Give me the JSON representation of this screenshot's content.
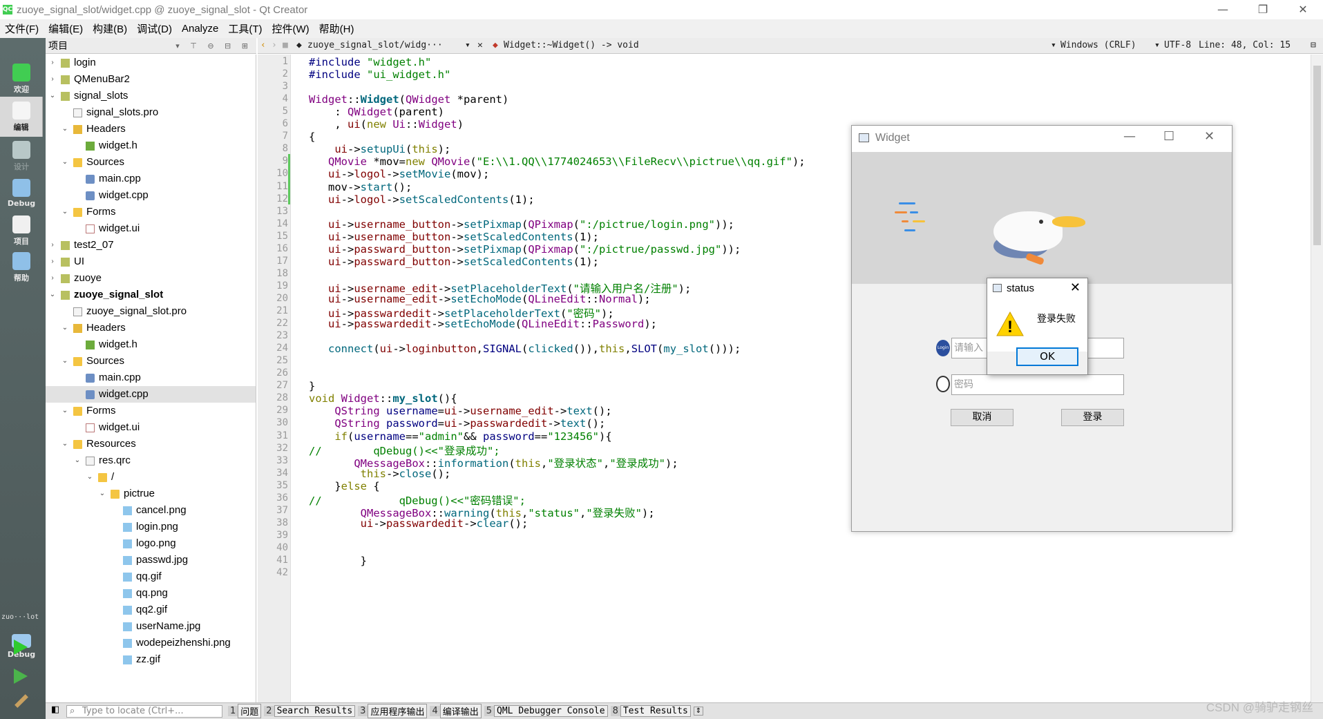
{
  "window": {
    "title": "zuoye_signal_slot/widget.cpp @ zuoye_signal_slot - Qt Creator",
    "app_icon": "QC"
  },
  "menu": [
    "文件(F)",
    "编辑(E)",
    "构建(B)",
    "调试(D)",
    "Analyze",
    "工具(T)",
    "控件(W)",
    "帮助(H)"
  ],
  "modes": [
    {
      "label": "欢迎",
      "icon": "qt-welcome-icon"
    },
    {
      "label": "编辑",
      "icon": "edit-icon"
    },
    {
      "label": "设计",
      "icon": "design-icon"
    },
    {
      "label": "Debug",
      "icon": "debug-icon"
    },
    {
      "label": "项目",
      "icon": "projects-icon"
    },
    {
      "label": "帮助",
      "icon": "help-icon"
    }
  ],
  "kit": {
    "label": "zuo···lot",
    "mode": "Debug"
  },
  "project_pane": {
    "title": "项目"
  },
  "tree": [
    {
      "label": "login",
      "indent": 0,
      "arrow": "›",
      "icon": "proj"
    },
    {
      "label": "QMenuBar2",
      "indent": 0,
      "arrow": "›",
      "icon": "proj"
    },
    {
      "label": "signal_slots",
      "indent": 0,
      "arrow": "⌄",
      "icon": "proj"
    },
    {
      "label": "signal_slots.pro",
      "indent": 1,
      "arrow": "",
      "icon": "pro"
    },
    {
      "label": "Headers",
      "indent": 1,
      "arrow": "⌄",
      "icon": "folder-g"
    },
    {
      "label": "widget.h",
      "indent": 2,
      "arrow": "",
      "icon": "h"
    },
    {
      "label": "Sources",
      "indent": 1,
      "arrow": "⌄",
      "icon": "folder"
    },
    {
      "label": "main.cpp",
      "indent": 2,
      "arrow": "",
      "icon": "cpp"
    },
    {
      "label": "widget.cpp",
      "indent": 2,
      "arrow": "",
      "icon": "cpp"
    },
    {
      "label": "Forms",
      "indent": 1,
      "arrow": "⌄",
      "icon": "folder"
    },
    {
      "label": "widget.ui",
      "indent": 2,
      "arrow": "",
      "icon": "ui"
    },
    {
      "label": "test2_07",
      "indent": 0,
      "arrow": "›",
      "icon": "proj"
    },
    {
      "label": "UI",
      "indent": 0,
      "arrow": "›",
      "icon": "proj"
    },
    {
      "label": "zuoye",
      "indent": 0,
      "arrow": "›",
      "icon": "proj"
    },
    {
      "label": "zuoye_signal_slot",
      "indent": 0,
      "arrow": "⌄",
      "icon": "proj",
      "bold": true
    },
    {
      "label": "zuoye_signal_slot.pro",
      "indent": 1,
      "arrow": "",
      "icon": "pro"
    },
    {
      "label": "Headers",
      "indent": 1,
      "arrow": "⌄",
      "icon": "folder-g"
    },
    {
      "label": "widget.h",
      "indent": 2,
      "arrow": "",
      "icon": "h"
    },
    {
      "label": "Sources",
      "indent": 1,
      "arrow": "⌄",
      "icon": "folder"
    },
    {
      "label": "main.cpp",
      "indent": 2,
      "arrow": "",
      "icon": "cpp"
    },
    {
      "label": "widget.cpp",
      "indent": 2,
      "arrow": "",
      "icon": "cpp",
      "selected": true
    },
    {
      "label": "Forms",
      "indent": 1,
      "arrow": "⌄",
      "icon": "folder"
    },
    {
      "label": "widget.ui",
      "indent": 2,
      "arrow": "",
      "icon": "ui"
    },
    {
      "label": "Resources",
      "indent": 1,
      "arrow": "⌄",
      "icon": "folder"
    },
    {
      "label": "res.qrc",
      "indent": 2,
      "arrow": "⌄",
      "icon": "pro"
    },
    {
      "label": "/",
      "indent": 3,
      "arrow": "⌄",
      "icon": "folder"
    },
    {
      "label": "pictrue",
      "indent": 4,
      "arrow": "⌄",
      "icon": "folder"
    },
    {
      "label": "cancel.png",
      "indent": 5,
      "arrow": "",
      "icon": "img"
    },
    {
      "label": "login.png",
      "indent": 5,
      "arrow": "",
      "icon": "img"
    },
    {
      "label": "logo.png",
      "indent": 5,
      "arrow": "",
      "icon": "img"
    },
    {
      "label": "passwd.jpg",
      "indent": 5,
      "arrow": "",
      "icon": "img"
    },
    {
      "label": "qq.gif",
      "indent": 5,
      "arrow": "",
      "icon": "img"
    },
    {
      "label": "qq.png",
      "indent": 5,
      "arrow": "",
      "icon": "img"
    },
    {
      "label": "qq2.gif",
      "indent": 5,
      "arrow": "",
      "icon": "img"
    },
    {
      "label": "userName.jpg",
      "indent": 5,
      "arrow": "",
      "icon": "img"
    },
    {
      "label": "wodepeizhenshi.png",
      "indent": 5,
      "arrow": "",
      "icon": "img"
    },
    {
      "label": "zz.gif",
      "indent": 5,
      "arrow": "",
      "icon": "img"
    }
  ],
  "editor": {
    "file_combo": "zuoye_signal_slot/widg···",
    "symbol_combo": "Widget::~Widget() -> void",
    "line_ending": "Windows (CRLF)",
    "encoding": "UTF-8",
    "position": "Line: 48, Col: 15"
  },
  "code": [
    [
      [
        "#include ",
        "#000080"
      ],
      [
        "\"widget.h\"",
        "#008000"
      ]
    ],
    [
      [
        "#include ",
        "#000080"
      ],
      [
        "\"ui_widget.h\"",
        "#008000"
      ]
    ],
    [],
    [
      [
        "Widget",
        "#800080"
      ],
      [
        "::",
        ""
      ],
      [
        "Widget",
        "#00677c",
        "b"
      ],
      [
        "(",
        ""
      ],
      [
        "QWidget",
        "#800080"
      ],
      [
        " *parent)",
        ""
      ]
    ],
    [
      [
        "    : ",
        ""
      ],
      [
        "QWidget",
        "#800080"
      ],
      [
        "(parent)",
        ""
      ]
    ],
    [
      [
        "    , ",
        ""
      ],
      [
        "ui",
        "#800000"
      ],
      [
        "(",
        ""
      ],
      [
        "new ",
        "#808000"
      ],
      [
        "Ui",
        "#800080"
      ],
      [
        "::",
        ""
      ],
      [
        "Widget",
        "#800080"
      ],
      [
        ")",
        ""
      ]
    ],
    [
      [
        "{",
        ""
      ]
    ],
    [
      [
        "    ",
        ""
      ],
      [
        "ui",
        "#800000"
      ],
      [
        "->",
        ""
      ],
      [
        "setupUi",
        "#00677c"
      ],
      [
        "(",
        ""
      ],
      [
        "this",
        "#808000"
      ],
      [
        ");",
        ""
      ]
    ],
    [
      [
        "   ",
        ""
      ],
      [
        "QMovie",
        "#800080"
      ],
      [
        " *mov=",
        ""
      ],
      [
        "new ",
        "#808000"
      ],
      [
        "QMovie",
        "#800080"
      ],
      [
        "(",
        ""
      ],
      [
        "\"E:\\\\1.QQ\\\\1774024653\\\\FileRecv\\\\pictrue\\\\qq.gif\"",
        "#008000"
      ],
      [
        ");",
        ""
      ]
    ],
    [
      [
        "   ",
        ""
      ],
      [
        "ui",
        "#800000"
      ],
      [
        "->",
        ""
      ],
      [
        "logol",
        "#800000"
      ],
      [
        "->",
        ""
      ],
      [
        "setMovie",
        "#00677c"
      ],
      [
        "(mov);",
        ""
      ]
    ],
    [
      [
        "   mov->",
        ""
      ],
      [
        "start",
        "#00677c"
      ],
      [
        "();",
        ""
      ]
    ],
    [
      [
        "   ",
        ""
      ],
      [
        "ui",
        "#800000"
      ],
      [
        "->",
        ""
      ],
      [
        "logol",
        "#800000"
      ],
      [
        "->",
        ""
      ],
      [
        "setScaledContents",
        "#00677c"
      ],
      [
        "(1);",
        ""
      ]
    ],
    [],
    [
      [
        "   ",
        ""
      ],
      [
        "ui",
        "#800000"
      ],
      [
        "->",
        ""
      ],
      [
        "username_button",
        "#800000"
      ],
      [
        "->",
        ""
      ],
      [
        "setPixmap",
        "#00677c"
      ],
      [
        "(",
        ""
      ],
      [
        "QPixmap",
        "#800080"
      ],
      [
        "(",
        ""
      ],
      [
        "\":/pictrue/login.png\"",
        "#008000"
      ],
      [
        "));",
        ""
      ]
    ],
    [
      [
        "   ",
        ""
      ],
      [
        "ui",
        "#800000"
      ],
      [
        "->",
        ""
      ],
      [
        "username_button",
        "#800000"
      ],
      [
        "->",
        ""
      ],
      [
        "setScaledContents",
        "#00677c"
      ],
      [
        "(1);",
        ""
      ]
    ],
    [
      [
        "   ",
        ""
      ],
      [
        "ui",
        "#800000"
      ],
      [
        "->",
        ""
      ],
      [
        "passward_button",
        "#800000"
      ],
      [
        "->",
        ""
      ],
      [
        "setPixmap",
        "#00677c"
      ],
      [
        "(",
        ""
      ],
      [
        "QPixmap",
        "#800080"
      ],
      [
        "(",
        ""
      ],
      [
        "\":/pictrue/passwd.jpg\"",
        "#008000"
      ],
      [
        "));",
        ""
      ]
    ],
    [
      [
        "   ",
        ""
      ],
      [
        "ui",
        "#800000"
      ],
      [
        "->",
        ""
      ],
      [
        "passward_button",
        "#800000"
      ],
      [
        "->",
        ""
      ],
      [
        "setScaledContents",
        "#00677c"
      ],
      [
        "(1);",
        ""
      ]
    ],
    [],
    [
      [
        "   ",
        ""
      ],
      [
        "ui",
        "#800000"
      ],
      [
        "->",
        ""
      ],
      [
        "username_edit",
        "#800000"
      ],
      [
        "->",
        ""
      ],
      [
        "setPlaceholderText",
        "#00677c"
      ],
      [
        "(",
        ""
      ],
      [
        "\"请输入用户名/注册\"",
        "#008000"
      ],
      [
        ");",
        ""
      ]
    ],
    [
      [
        "   ",
        ""
      ],
      [
        "ui",
        "#800000"
      ],
      [
        "->",
        ""
      ],
      [
        "username_edit",
        "#800000"
      ],
      [
        "->",
        ""
      ],
      [
        "setEchoMode",
        "#00677c"
      ],
      [
        "(",
        ""
      ],
      [
        "QLineEdit",
        "#800080"
      ],
      [
        "::",
        ""
      ],
      [
        "Normal",
        "#800080"
      ],
      [
        ");",
        ""
      ]
    ],
    [
      [
        "   ",
        ""
      ],
      [
        "ui",
        "#800000"
      ],
      [
        "->",
        ""
      ],
      [
        "passwardedit",
        "#800000"
      ],
      [
        "->",
        ""
      ],
      [
        "setPlaceholderText",
        "#00677c"
      ],
      [
        "(",
        ""
      ],
      [
        "\"密码\"",
        "#008000"
      ],
      [
        ");",
        ""
      ]
    ],
    [
      [
        "   ",
        ""
      ],
      [
        "ui",
        "#800000"
      ],
      [
        "->",
        ""
      ],
      [
        "passwardedit",
        "#800000"
      ],
      [
        "->",
        ""
      ],
      [
        "setEchoMode",
        "#00677c"
      ],
      [
        "(",
        ""
      ],
      [
        "QLineEdit",
        "#800080"
      ],
      [
        "::",
        ""
      ],
      [
        "Password",
        "#800080"
      ],
      [
        ");",
        ""
      ]
    ],
    [],
    [
      [
        "   ",
        ""
      ],
      [
        "connect",
        "#00677c"
      ],
      [
        "(",
        ""
      ],
      [
        "ui",
        "#800000"
      ],
      [
        "->",
        ""
      ],
      [
        "loginbutton",
        "#800000"
      ],
      [
        ",",
        ""
      ],
      [
        "SIGNAL",
        "#000080"
      ],
      [
        "(",
        ""
      ],
      [
        "clicked",
        "#00677c"
      ],
      [
        "()),",
        ""
      ],
      [
        "this",
        "#808000"
      ],
      [
        ",",
        ""
      ],
      [
        "SLOT",
        "#000080"
      ],
      [
        "(",
        ""
      ],
      [
        "my_slot",
        "#00677c"
      ],
      [
        "()));",
        ""
      ]
    ],
    [],
    [],
    [
      [
        "}",
        ""
      ]
    ],
    [
      [
        "void ",
        "#808000"
      ],
      [
        "Widget",
        "#800080"
      ],
      [
        "::",
        ""
      ],
      [
        "my_slot",
        "#00677c",
        "b"
      ],
      [
        "(){",
        ""
      ]
    ],
    [
      [
        "    ",
        ""
      ],
      [
        "QString",
        "#800080"
      ],
      [
        " ",
        ""
      ],
      [
        "username",
        "#000080"
      ],
      [
        "=",
        ""
      ],
      [
        "ui",
        "#800000"
      ],
      [
        "->",
        ""
      ],
      [
        "username_edit",
        "#800000"
      ],
      [
        "->",
        ""
      ],
      [
        "text",
        "#00677c"
      ],
      [
        "();",
        ""
      ]
    ],
    [
      [
        "    ",
        ""
      ],
      [
        "QString",
        "#800080"
      ],
      [
        " ",
        ""
      ],
      [
        "password",
        "#000080"
      ],
      [
        "=",
        ""
      ],
      [
        "ui",
        "#800000"
      ],
      [
        "->",
        ""
      ],
      [
        "passwardedit",
        "#800000"
      ],
      [
        "->",
        ""
      ],
      [
        "text",
        "#00677c"
      ],
      [
        "();",
        ""
      ]
    ],
    [
      [
        "    ",
        ""
      ],
      [
        "if",
        "#808000"
      ],
      [
        "(",
        ""
      ],
      [
        "username",
        "#000080"
      ],
      [
        "==",
        ""
      ],
      [
        "\"admin\"",
        "#008000"
      ],
      [
        "&& ",
        ""
      ],
      [
        "password",
        "#000080"
      ],
      [
        "==",
        ""
      ],
      [
        "\"123456\"",
        "#008000"
      ],
      [
        "){",
        ""
      ]
    ],
    [
      [
        "//        qDebug()<<\"登录成功\";",
        "#008000"
      ]
    ],
    [
      [
        "       ",
        ""
      ],
      [
        "QMessageBox",
        "#800080"
      ],
      [
        "::",
        ""
      ],
      [
        "information",
        "#00677c"
      ],
      [
        "(",
        ""
      ],
      [
        "this",
        "#808000"
      ],
      [
        ",",
        ""
      ],
      [
        "\"登录状态\"",
        "#008000"
      ],
      [
        ",",
        ""
      ],
      [
        "\"登录成功\"",
        "#008000"
      ],
      [
        ");",
        ""
      ]
    ],
    [
      [
        "        ",
        ""
      ],
      [
        "this",
        "#808000"
      ],
      [
        "->",
        ""
      ],
      [
        "close",
        "#00677c"
      ],
      [
        "();",
        ""
      ]
    ],
    [
      [
        "    }",
        ""
      ],
      [
        "else",
        "#808000"
      ],
      [
        " {",
        ""
      ]
    ],
    [
      [
        "//            qDebug()<<\"密码错误\";",
        "#008000"
      ]
    ],
    [
      [
        "        ",
        ""
      ],
      [
        "QMessageBox",
        "#800080"
      ],
      [
        "::",
        ""
      ],
      [
        "warning",
        "#00677c"
      ],
      [
        "(",
        ""
      ],
      [
        "this",
        "#808000"
      ],
      [
        ",",
        ""
      ],
      [
        "\"status\"",
        "#008000"
      ],
      [
        ",",
        ""
      ],
      [
        "\"登录失败\"",
        "#008000"
      ],
      [
        ");",
        ""
      ]
    ],
    [
      [
        "        ",
        ""
      ],
      [
        "ui",
        "#800000"
      ],
      [
        "->",
        ""
      ],
      [
        "passwardedit",
        "#800000"
      ],
      [
        "->",
        ""
      ],
      [
        "clear",
        "#00677c"
      ],
      [
        "();",
        ""
      ]
    ],
    [],
    [],
    [
      [
        "        }",
        ""
      ]
    ],
    []
  ],
  "fold_lines": [
    6,
    28,
    31,
    35
  ],
  "output_tabs": [
    {
      "n": "1",
      "label": "问题"
    },
    {
      "n": "2",
      "label": "Search Results"
    },
    {
      "n": "3",
      "label": "应用程序输出"
    },
    {
      "n": "4",
      "label": "编译输出"
    },
    {
      "n": "5",
      "label": "QML Debugger Console"
    },
    {
      "n": "8",
      "label": "Test Results"
    }
  ],
  "locator": {
    "placeholder": "Type to locate (Ctrl+..."
  },
  "watermark": "CSDN @骑驴走钢丝",
  "widget_window": {
    "title": "Widget",
    "username_placeholder": "请输入",
    "password_placeholder": "密码",
    "cancel_label": "取消",
    "login_label": "登录",
    "user_icon_text": "Login"
  },
  "status_dialog": {
    "title": "status",
    "message": "登录失败",
    "ok_label": "OK",
    "warning_glyph": "!"
  }
}
